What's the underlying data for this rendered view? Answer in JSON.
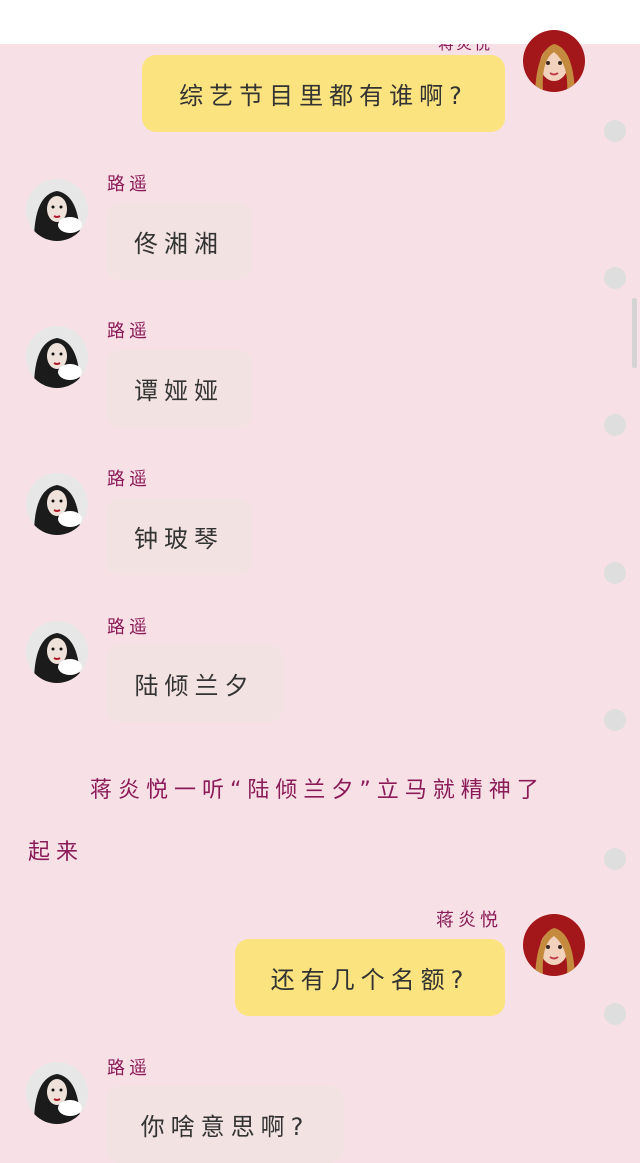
{
  "chat": {
    "top_partial_name": "蒋炎悦",
    "messages": [
      {
        "side": "me",
        "sender": "",
        "text": "综艺节目里都有谁啊?"
      },
      {
        "side": "them",
        "sender": "路遥",
        "text": "佟湘湘"
      },
      {
        "side": "them",
        "sender": "路遥",
        "text": "谭娅娅"
      },
      {
        "side": "them",
        "sender": "路遥",
        "text": "钟玻琴"
      },
      {
        "side": "them",
        "sender": "路遥",
        "text": "陆倾兰夕"
      },
      {
        "side": "me",
        "sender": "蒋炎悦",
        "text": "还有几个名额?"
      },
      {
        "side": "them",
        "sender": "路遥",
        "text": "你啥意思啊?"
      }
    ],
    "narration_line1": "蒋炎悦一听“陆倾兰夕”立马就精神了",
    "narration_line2": "起来"
  },
  "colors": {
    "background": "#f8e1e6",
    "me_bubble": "#fbe37f",
    "them_bubble": "#f2e2e2",
    "name_color": "#8a1b58"
  }
}
